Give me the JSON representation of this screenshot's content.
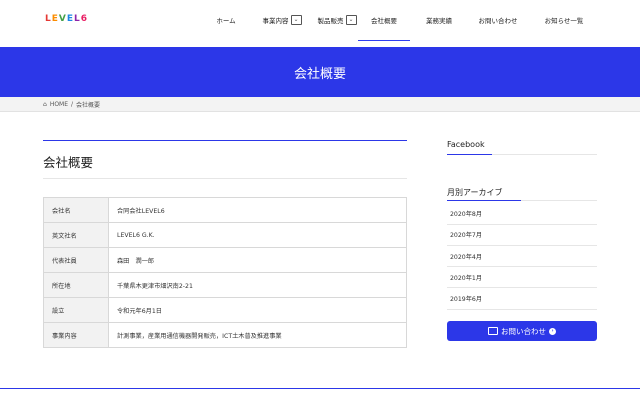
{
  "logo": {
    "text": "LEVEL6"
  },
  "nav": {
    "items": [
      {
        "label": "ホーム"
      },
      {
        "label": "事業内容"
      },
      {
        "label": "製品販売"
      },
      {
        "label": "会社概要"
      },
      {
        "label": "業務実績"
      },
      {
        "label": "お問い合わせ"
      },
      {
        "label": "お知らせ一覧"
      }
    ],
    "dropdown_glyph": "⌄"
  },
  "banner": {
    "title": "会社概要"
  },
  "breadcrumb": {
    "home": "HOME",
    "separator": "/",
    "current": "会社概要"
  },
  "main": {
    "title": "会社概要",
    "rows": [
      {
        "label": "会社名",
        "value": "合同会社LEVEL6"
      },
      {
        "label": "英文社名",
        "value": "LEVEL6 G.K."
      },
      {
        "label": "代表社員",
        "value": "森田　潤一郎"
      },
      {
        "label": "所在地",
        "value": "千葉県木更津市畑沢南2-21"
      },
      {
        "label": "設立",
        "value": "令和元年6月1日"
      },
      {
        "label": "事業内容",
        "value": "計測事業，産業用通信機器開発販売，ICT土木普及推進事業"
      }
    ]
  },
  "sidebar": {
    "facebook_title": "Facebook",
    "archive_title": "月別アーカイブ",
    "archives": [
      "2020年8月",
      "2020年7月",
      "2020年4月",
      "2020年1月",
      "2019年6月"
    ],
    "contact_label": "お問い合わせ"
  },
  "colors": {
    "accent": "#2c37e8"
  }
}
